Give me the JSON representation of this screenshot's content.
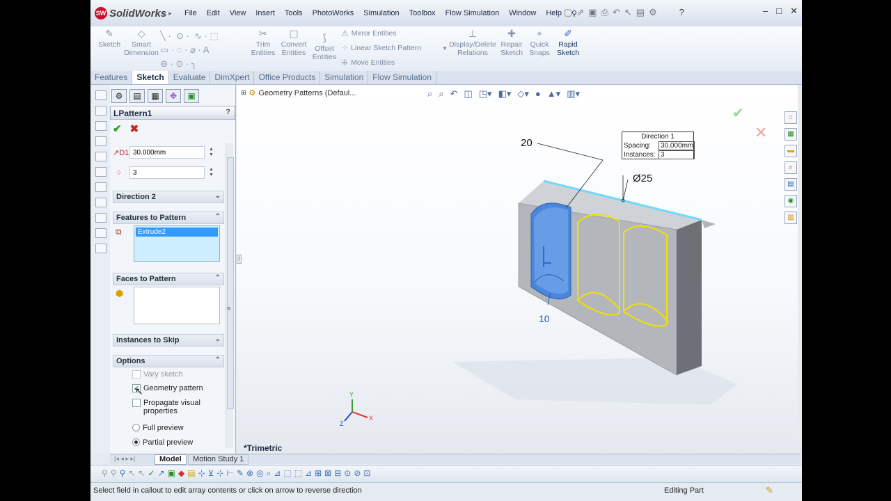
{
  "app": {
    "name": "SolidWorks",
    "menu": [
      "File",
      "Edit",
      "View",
      "Insert",
      "Tools",
      "PhotoWorks",
      "Simulation",
      "Toolbox",
      "Flow Simulation",
      "Window",
      "Help"
    ]
  },
  "ribbon": {
    "sketch": "Sketch",
    "smart_dimension": [
      "Smart",
      "Dimension"
    ],
    "trim": [
      "Trim",
      "Entities"
    ],
    "convert": [
      "Convert",
      "Entities"
    ],
    "offset": [
      "Offset",
      "Entities"
    ],
    "mirror": "Mirror Entities",
    "linear_pattern": "Linear Sketch Pattern",
    "move": "Move Entities",
    "display_delete": [
      "Display/Delete",
      "Relations"
    ],
    "repair": [
      "Repair",
      "Sketch"
    ],
    "quick_snaps": [
      "Quick",
      "Snaps"
    ],
    "rapid_sketch": [
      "Rapid",
      "Sketch"
    ]
  },
  "cm_tabs": [
    "Features",
    "Sketch",
    "Evaluate",
    "DimXpert",
    "Office Products",
    "Simulation",
    "Flow Simulation"
  ],
  "property_manager": {
    "title": "LPattern1",
    "help": "?",
    "spacing_value": "30.000mm",
    "instances_value": "3",
    "direction2": "Direction 2",
    "features_to_pattern": "Features to Pattern",
    "features_item": "Extrude2",
    "faces_to_pattern": "Faces to Pattern",
    "instances_to_skip": "Instances to Skip",
    "options": "Options",
    "vary_sketch": "Vary sketch",
    "geometry_pattern": "Geometry pattern",
    "propagate": [
      "Propagate visual",
      "properties"
    ],
    "full_preview": "Full preview",
    "partial_preview": "Partial preview"
  },
  "graphics": {
    "tree_label": "Geometry Patterns  (Defaul...",
    "view_label": "*Trimetric",
    "callout_title": "Direction 1",
    "callout_spacing_label": "Spacing:",
    "callout_spacing_value": "30.000mm",
    "callout_instances_label": "Instances:",
    "callout_instances_value": "3",
    "dim_20": "20",
    "dim_25": "Ø25",
    "dim_10": "10",
    "axis_x": "X",
    "axis_y": "Y",
    "axis_z": "Z"
  },
  "bottom_tabs": [
    "Model",
    "Motion Study 1"
  ],
  "status": {
    "message": "Select field in callout to edit array contents or click on arrow to reverse direction",
    "mode": "Editing Part"
  },
  "colors": {
    "accent_blue": "#3b78d8",
    "preview_yellow": "#f2e000",
    "edge_cyan": "#6fd8ff",
    "ok_green": "#2d9a2b",
    "cancel_red": "#c62828"
  }
}
